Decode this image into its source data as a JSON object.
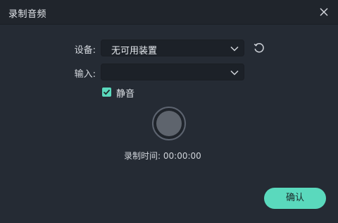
{
  "dialog": {
    "title": "录制音频",
    "close_icon": "close-icon"
  },
  "device": {
    "label": "设备:",
    "value": "无可用装置",
    "refresh_icon": "refresh-icon"
  },
  "input": {
    "label": "输入:",
    "value": ""
  },
  "mute": {
    "label": "静音",
    "checked": true
  },
  "recording": {
    "time_label": "录制时间:",
    "time_value": "00:00:00"
  },
  "actions": {
    "confirm_label": "确认"
  },
  "colors": {
    "accent": "#5ad9bd",
    "background": "#252b34",
    "titlebar": "#20252c"
  }
}
